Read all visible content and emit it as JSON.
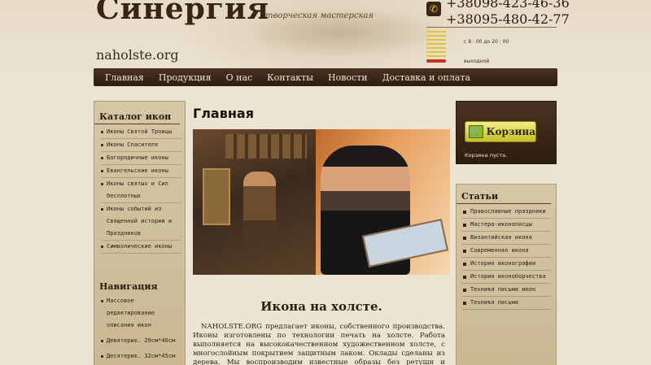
{
  "header": {
    "logo": "Синергия",
    "tagline": "творческая мастерская",
    "domain": "naholste.org",
    "phone_icon": "phone-icon",
    "phones": [
      "+38098-423-46-36",
      "+38095-480-42-77"
    ],
    "hours": "с 8 : 00 до 20 : 00",
    "day_off": "выходной"
  },
  "nav": {
    "items": [
      "Главная",
      "Продукция",
      "О нас",
      "Контакты",
      "Новости",
      "Доставка и оплата"
    ]
  },
  "catalog": {
    "title": "Каталог икон",
    "items": [
      "Иконы Святой Троицы",
      "Иконы Спасителя",
      "Богородичные иконы",
      "Евангельские иконы",
      "Иконы святых и Сил бесплотных",
      "Иконы событий из Священной истории и Праздников",
      "Символические иконы"
    ]
  },
  "navigation": {
    "title": "Навигация",
    "items": [
      "Массовое редактирование описания икон",
      "Девятерик. 29см*40см",
      "Десятерик. 32см*45см"
    ]
  },
  "main": {
    "page_title": "Главная",
    "article_title": "Икона на холсте.",
    "article_body": "NAHOLSTE.ORG предлагает иконы, собственного производства. Иконы изготовлены по технологии печать на холсте. Работа выполняется на высококачественном художественном холсте, с многослойным покрытием защитным лаком. Оклады сделаны из дерева. Мы воспроизводим известные образы без ретуши и стилизации."
  },
  "cart": {
    "button_label": "Корзина",
    "icon": "cart-icon",
    "empty_text": "Корзина пуста."
  },
  "articles": {
    "title": "Статьи",
    "items": [
      "Православные праздники",
      "Мастера-иконописцы",
      "Византийская икона",
      "Современная икона",
      "История иконографии",
      "История иконоборчества",
      "Техника письма икон",
      "Техника письма"
    ]
  },
  "colors": {
    "nav_bg": "#3a2616",
    "panel_bg": "#d0bf9c",
    "cart_button": "#e6dc5a"
  }
}
